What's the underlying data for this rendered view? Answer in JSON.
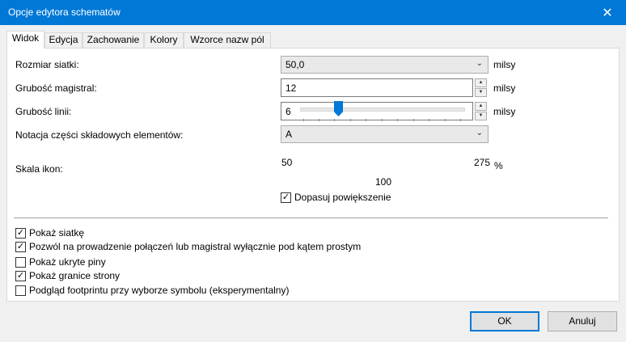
{
  "window": {
    "title": "Opcje edytora schematów"
  },
  "tabs": [
    {
      "label": "Widok"
    },
    {
      "label": "Edycja"
    },
    {
      "label": "Zachowanie"
    },
    {
      "label": "Kolory"
    },
    {
      "label": "Wzorce nazw pól"
    }
  ],
  "view": {
    "grid_size": {
      "label": "Rozmiar siatki:",
      "value": "50,0",
      "unit": "milsy"
    },
    "bus_width": {
      "label": "Grubość magistral:",
      "value": "12",
      "unit": "milsy"
    },
    "line_width": {
      "label": "Grubość linii:",
      "value": "6",
      "unit": "milsy"
    },
    "unit_notation": {
      "label": "Notacja części składowych elementów:",
      "value": "A"
    },
    "icon_scale": {
      "label": "Skala ikon:",
      "min": "50",
      "max": "275",
      "value": "100",
      "unit": "%",
      "level": 100
    },
    "fit_zoom": {
      "label": "Dopasuj powiększenie",
      "checked": true
    },
    "options": [
      {
        "label": "Pokaż siatkę",
        "checked": true
      },
      {
        "label": "Pozwól na prowadzenie połączeń lub magistral wyłącznie pod kątem prostym",
        "checked": true
      },
      {
        "label": "Pokaż ukryte piny",
        "checked": false
      },
      {
        "label": "Pokaż granice strony",
        "checked": true
      },
      {
        "label": "Podgląd footprintu przy wyborze symbolu (eksperymentalny)",
        "checked": false
      }
    ]
  },
  "buttons": {
    "ok": "OK",
    "cancel": "Anuluj"
  },
  "icons": {
    "close": "close-icon",
    "dropdown": "chevron-down-icon",
    "spin_up": "spin-up-icon",
    "spin_down": "spin-down-icon",
    "check": "check-icon"
  },
  "colors": {
    "titlebar": "#0078d7",
    "accent": "#0078d7"
  }
}
